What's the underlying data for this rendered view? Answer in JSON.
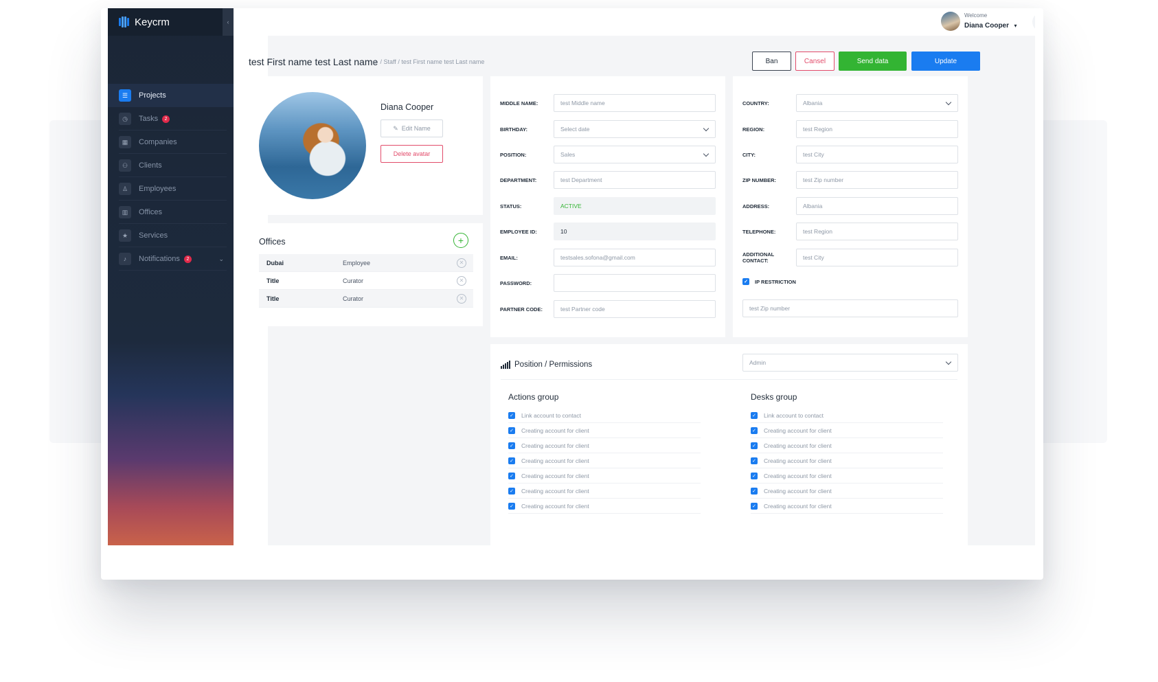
{
  "brand": {
    "name": "Keycrm"
  },
  "user": {
    "welcome": "Welcome",
    "name": "Diana Cooper",
    "lang": "en",
    "notifications": "2"
  },
  "sidebar": {
    "items": [
      {
        "label": "Projects",
        "icon": "stack-icon",
        "active": true
      },
      {
        "label": "Tasks",
        "icon": "clock-icon",
        "badge": "2"
      },
      {
        "label": "Companies",
        "icon": "building-icon"
      },
      {
        "label": "Clients",
        "icon": "users-icon"
      },
      {
        "label": "Employees",
        "icon": "person-icon"
      },
      {
        "label": "Offices",
        "icon": "office-icon"
      },
      {
        "label": "Services",
        "icon": "star-icon"
      },
      {
        "label": "Notifications",
        "icon": "bell-icon",
        "badge": "2"
      }
    ]
  },
  "page": {
    "title": "test First name test Last name",
    "breadcrumb": {
      "staff": "Staff",
      "current": "test First name test Last name"
    }
  },
  "actions": {
    "ban": "Ban",
    "cancel": "Cansel",
    "send": "Send data",
    "update": "Update"
  },
  "profile": {
    "name": "Diana Cooper",
    "edit": "Edit Name",
    "delete": "Delete avatar"
  },
  "offices": {
    "title": "Offices",
    "rows": [
      {
        "name": "Dubai",
        "role": "Employee"
      },
      {
        "name": "Title",
        "role": "Curator"
      },
      {
        "name": "Title",
        "role": "Curator"
      }
    ]
  },
  "form_left": {
    "middle_name": {
      "label": "MIDDLE NAME:",
      "value": "test Middle name"
    },
    "birthday": {
      "label": "BIRTHDAY:",
      "value": "Select date"
    },
    "position": {
      "label": "POSITION:",
      "value": "Sales"
    },
    "department": {
      "label": "DEPARTMENT:",
      "value": "test Department"
    },
    "status": {
      "label": "STATUS:",
      "value": "ACTIVE"
    },
    "employee_id": {
      "label": "EMPLOYEE ID:",
      "value": "10"
    },
    "email": {
      "label": "EMAIL:",
      "value": "testsales.sofona@gmail.com"
    },
    "password": {
      "label": "PASSWORD:",
      "value": ""
    },
    "partner_code": {
      "label": "PARTNER CODE:",
      "value": "test Partner code"
    }
  },
  "form_right": {
    "country": {
      "label": "COUNTRY:",
      "value": "Albania"
    },
    "region": {
      "label": "REGION:",
      "value": "test Region"
    },
    "city": {
      "label": "CITY:",
      "value": "test City"
    },
    "zip": {
      "label": "ZIP NUMBER:",
      "value": "test Zip number"
    },
    "address": {
      "label": "ADDRESS:",
      "value": "Albania"
    },
    "telephone": {
      "label": "TELEPHONE:",
      "value": "test Region"
    },
    "additional": {
      "label": "ADDITIONAL CONTACT:",
      "value": "test City"
    },
    "ip_restriction": {
      "label": "IP RESTRICTION",
      "value": "test Zip number"
    }
  },
  "permissions": {
    "title": "Position / Permissions",
    "role": "Admin",
    "actions_group": {
      "title": "Actions group",
      "items": [
        "Link account to contact",
        "Creating account for client",
        "Creating account for client",
        "Creating account for client",
        "Creating account for client",
        "Creating account for client",
        "Creating account for client"
      ]
    },
    "desks_group": {
      "title": "Desks group",
      "items": [
        "Link account to contact",
        "Creating account for client",
        "Creating account for client",
        "Creating account for client",
        "Creating account for client",
        "Creating account for client",
        "Creating account for client"
      ]
    }
  },
  "colors": {
    "accent": "#1a7cf0",
    "success": "#33b433",
    "danger": "#e24b6a",
    "sidebar": "#1b2636"
  }
}
